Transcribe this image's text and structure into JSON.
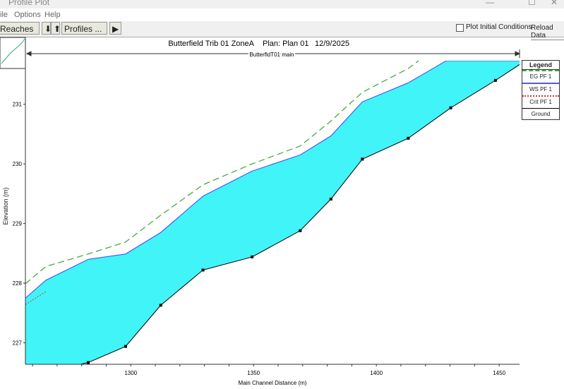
{
  "window": {
    "title": "Profile Plot"
  },
  "menu": [
    "ile",
    "Options",
    "Help"
  ],
  "toolbar": {
    "reaches": "Reaches ...",
    "down": "⬇",
    "up": "⬆",
    "profiles": "Profiles ...",
    "play": "▶",
    "plot_initial": "Plot Initial Conditions",
    "reload": "Reload Data"
  },
  "plot": {
    "title": "Butterfield Trib 01 ZoneA",
    "plan": "Plan: Plan 01",
    "date": "12/9/2025",
    "reach": "ButterfldT01 main"
  },
  "legend": {
    "title": "Legend",
    "items": [
      "EG  PF 1",
      "WS  PF 1",
      "Crit  PF 1",
      "Ground"
    ]
  },
  "chart_data": {
    "type": "line",
    "xlabel": "Main Channel Distance (m)",
    "ylabel": "Elevation (m)",
    "xlim": [
      1257.1,
      1458.3
    ],
    "ylim": [
      226.64,
      231.73
    ],
    "xticks": [
      1300,
      1350,
      1400,
      1450
    ],
    "yticks": [
      227,
      228,
      229,
      230,
      231
    ],
    "series": [
      {
        "name": "Ground",
        "color": "#000000",
        "x": [
          1254,
          1282.7,
          1297.9,
          1312.2,
          1329.4,
          1349.4,
          1369,
          1381.5,
          1394.3,
          1413,
          1430.3,
          1448.5,
          1460.7
        ],
        "y": [
          226.4,
          226.67,
          226.94,
          227.63,
          228.22,
          228.44,
          228.88,
          229.41,
          230.08,
          230.43,
          230.94,
          231.4,
          231.73
        ]
      },
      {
        "name": "WS PF 1",
        "color": "#4040ff",
        "x": [
          1257.1,
          1265.4,
          1282.7,
          1297.9,
          1312.2,
          1329.4,
          1349.4,
          1369,
          1381.5,
          1394.3,
          1413,
          1428.5,
          1460.7
        ],
        "y": [
          227.75,
          228.05,
          228.4,
          228.49,
          228.85,
          229.46,
          229.88,
          230.15,
          230.47,
          231.04,
          231.36,
          231.73,
          231.73
        ]
      },
      {
        "name": "EG PF 1",
        "color": "#44aa44",
        "x": [
          1257.1,
          1265.4,
          1282.7,
          1297.9,
          1312.2,
          1329.4,
          1349.4,
          1369,
          1381.5,
          1394.3,
          1413,
          1417.2
        ],
        "y": [
          227.99,
          228.28,
          228.49,
          228.69,
          229.14,
          229.65,
          230.0,
          230.3,
          230.72,
          231.2,
          231.6,
          231.73
        ]
      },
      {
        "name": "Crit PF 1",
        "color": "#dd3333",
        "x": [
          1257.1,
          1265.4
        ],
        "y": [
          227.64,
          227.86
        ]
      }
    ],
    "fill_color": "#40f4f8"
  }
}
